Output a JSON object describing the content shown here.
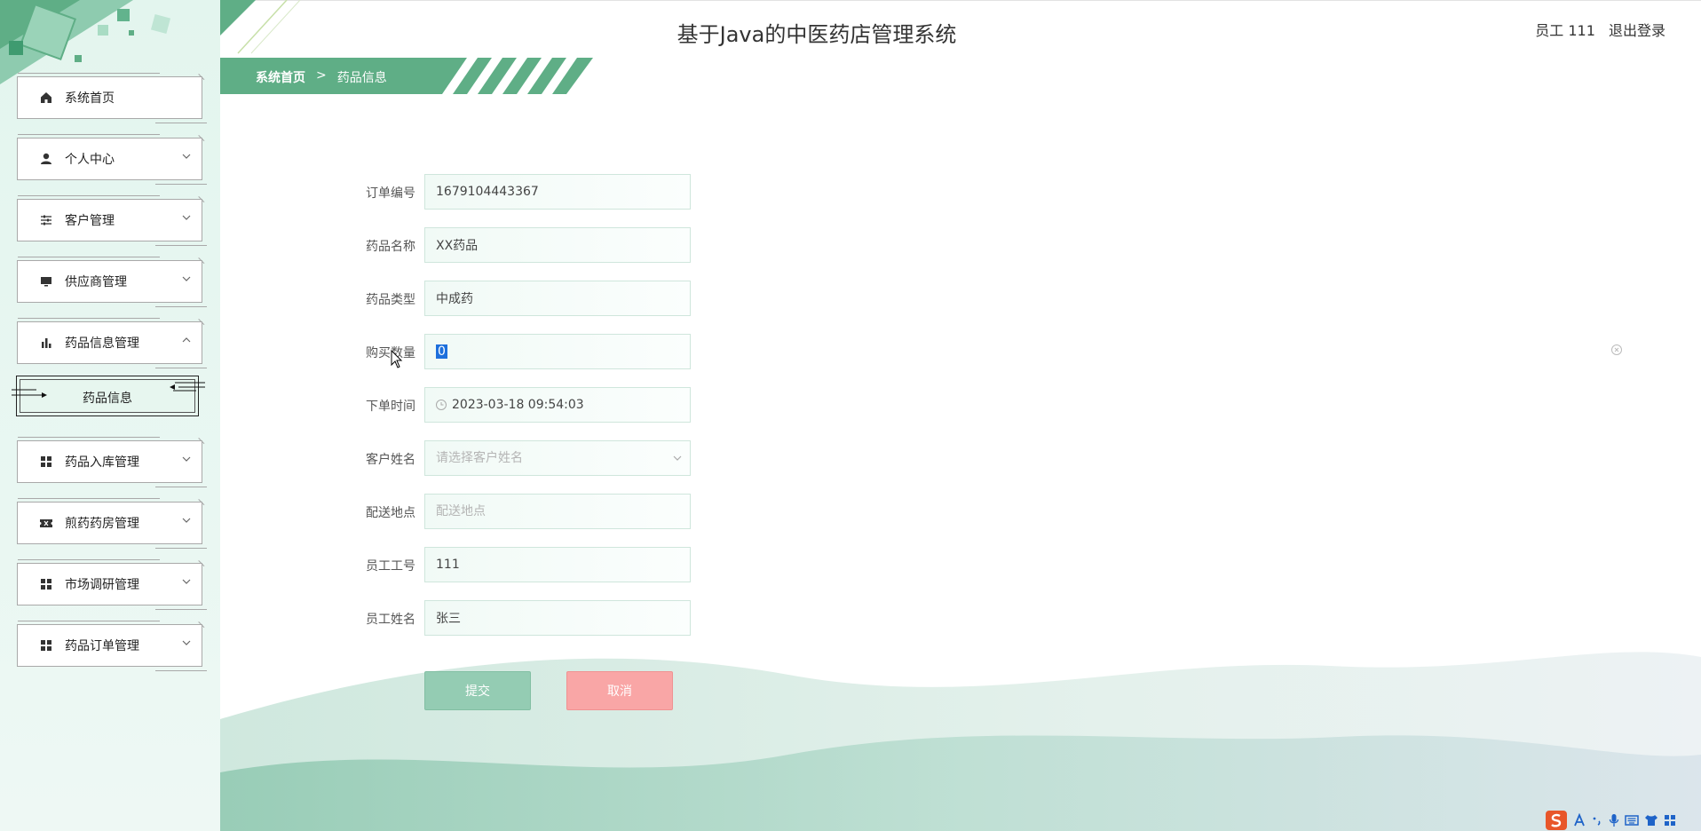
{
  "header": {
    "title": "基于Java的中医药店管理系统",
    "user_label": "员工 111",
    "logout_label": "退出登录"
  },
  "breadcrumb": {
    "home": "系统首页",
    "separator": ">",
    "current": "药品信息"
  },
  "sidebar": {
    "items": [
      {
        "label": "系统首页",
        "icon": "home-icon"
      },
      {
        "label": "个人中心",
        "icon": "person-icon"
      },
      {
        "label": "客户管理",
        "icon": "sliders-icon"
      },
      {
        "label": "供应商管理",
        "icon": "monitor-icon"
      },
      {
        "label": "药品信息管理",
        "icon": "bar-chart-icon",
        "expanded": true
      },
      {
        "label": "药品入库管理",
        "icon": "grid-icon"
      },
      {
        "label": "煎药药房管理",
        "icon": "ticket-icon"
      },
      {
        "label": "市场调研管理",
        "icon": "grid-icon"
      },
      {
        "label": "药品订单管理",
        "icon": "grid-icon"
      }
    ],
    "sub_item": "药品信息"
  },
  "form": {
    "order_no": {
      "label": "订单编号",
      "value": "1679104443367"
    },
    "drug_name": {
      "label": "药品名称",
      "value": "XX药品"
    },
    "drug_type": {
      "label": "药品类型",
      "value": "中成药"
    },
    "quantity": {
      "label": "购买数量",
      "value": "0"
    },
    "order_time": {
      "label": "下单时间",
      "value": "2023-03-18 09:54:03"
    },
    "customer_name": {
      "label": "客户姓名",
      "placeholder": "请选择客户姓名"
    },
    "address": {
      "label": "配送地点",
      "placeholder": "配送地点"
    },
    "staff_no": {
      "label": "员工工号",
      "value": "111"
    },
    "staff_name": {
      "label": "员工姓名",
      "value": "张三"
    },
    "submit_label": "提交",
    "cancel_label": "取消"
  },
  "colors": {
    "accent_green": "#5fae86",
    "submit_bg": "#94ccb3",
    "cancel_bg": "#f9a6a6",
    "sidebar_bg": "#e6f6ef"
  }
}
